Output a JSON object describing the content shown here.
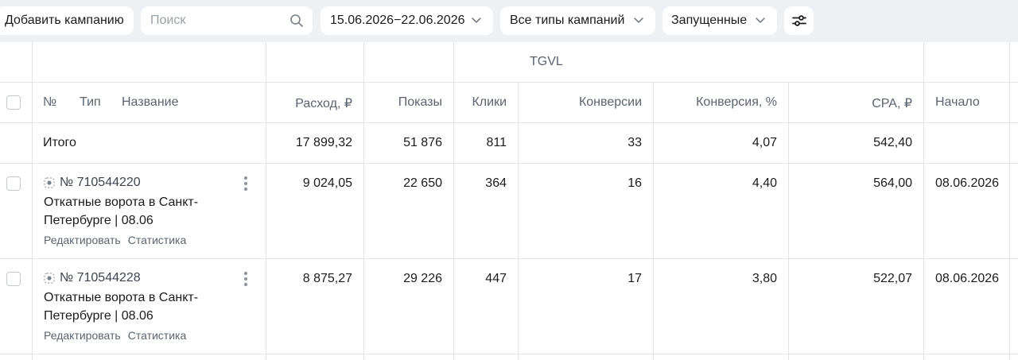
{
  "toolbar": {
    "add_campaign": "Добавить кампанию",
    "search_placeholder": "Поиск",
    "date_range": "15.06.2026−22.06.2026",
    "campaign_types": "Все типы кампаний",
    "campaign_state": "Запущенные"
  },
  "table": {
    "group_header": "TGVL",
    "columns": {
      "number": "№",
      "type": "Тип",
      "name": "Название",
      "spend": "Расход, ₽",
      "impressions": "Показы",
      "clicks": "Клики",
      "conversions": "Конверсии",
      "conversion_rate": "Конверсия, %",
      "cpa": "CPA, ₽",
      "start": "Начало"
    },
    "total": {
      "label": "Итого",
      "spend": "17 899,32",
      "impressions": "51 876",
      "clicks": "811",
      "conversions": "33",
      "conversion_rate": "4,07",
      "cpa": "542,40"
    },
    "rows": [
      {
        "id": "№ 710544220",
        "name": "Откатные ворота в Санкт-Петербурге | 08.06",
        "edit": "Редактировать",
        "stats": "Статистика",
        "spend": "9 024,05",
        "impressions": "22 650",
        "clicks": "364",
        "conversions": "16",
        "conversion_rate": "4,40",
        "cpa": "564,00",
        "start": "08.06.2026"
      },
      {
        "id": "№ 710544228",
        "name": "Откатные ворота в Санкт-Петербурге | 08.06",
        "edit": "Редактировать",
        "stats": "Статистика",
        "spend": "8 875,27",
        "impressions": "29 226",
        "clicks": "447",
        "conversions": "17",
        "conversion_rate": "3,80",
        "cpa": "522,07",
        "start": "08.06.2026"
      }
    ]
  },
  "colors": {
    "page_bg": "#eef0f4",
    "grid_line": "#e2e4e8",
    "header_text": "#5b6370"
  },
  "icons": [
    "search-icon",
    "chevron-down-icon",
    "filter-sliders-icon",
    "campaign-type-icon",
    "kebab-menu-icon"
  ]
}
